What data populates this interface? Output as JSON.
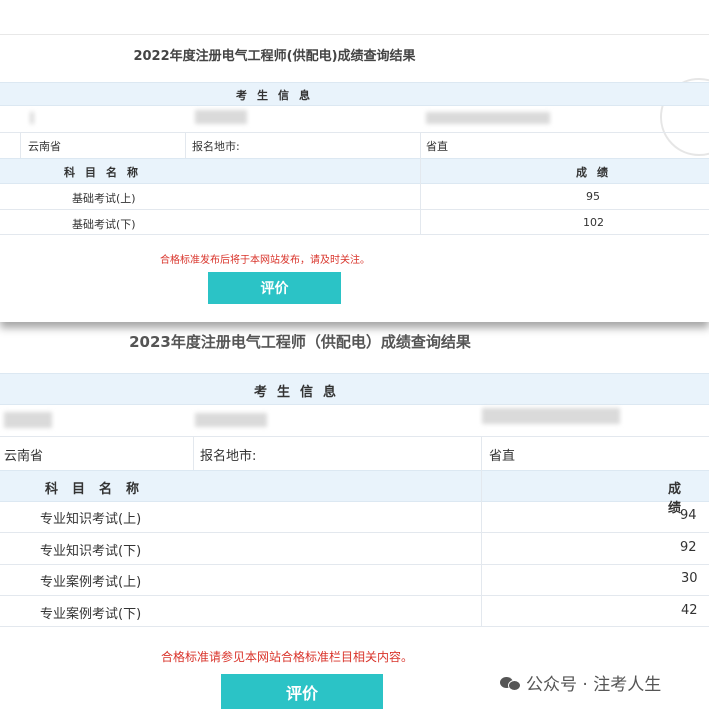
{
  "result2022": {
    "title": "2022年度注册电气工程师(供配电)成绩查询结果",
    "examinee_header": "考生信息",
    "province": "云南省",
    "city_label": "报名地市:",
    "city_value": "省直",
    "subject_header": "科目名称",
    "score_header": "成绩",
    "rows": [
      {
        "subject": "基础考试(上)",
        "score": "95"
      },
      {
        "subject": "基础考试(下)",
        "score": "102"
      }
    ],
    "note": "合格标准发布后将于本网站发布，请及时关注。",
    "button": "评价"
  },
  "result2023": {
    "title": "2023年度注册电气工程师（供配电）成绩查询结果",
    "examinee_header": "考生信息",
    "province": "云南省",
    "city_label": "报名地市:",
    "city_value": "省直",
    "subject_header": "科目名称",
    "score_header": "成绩",
    "rows": [
      {
        "subject": "专业知识考试(上)",
        "score": "94"
      },
      {
        "subject": "专业知识考试(下)",
        "score": "92"
      },
      {
        "subject": "专业案例考试(上)",
        "score": "30"
      },
      {
        "subject": "专业案例考试(下)",
        "score": "42"
      }
    ],
    "note": "合格标准请参见本网站合格标准栏目相关内容。",
    "button": "评价"
  },
  "watermark": {
    "text": "公众号 · 注考人生",
    "icon": "wechat-icon"
  }
}
